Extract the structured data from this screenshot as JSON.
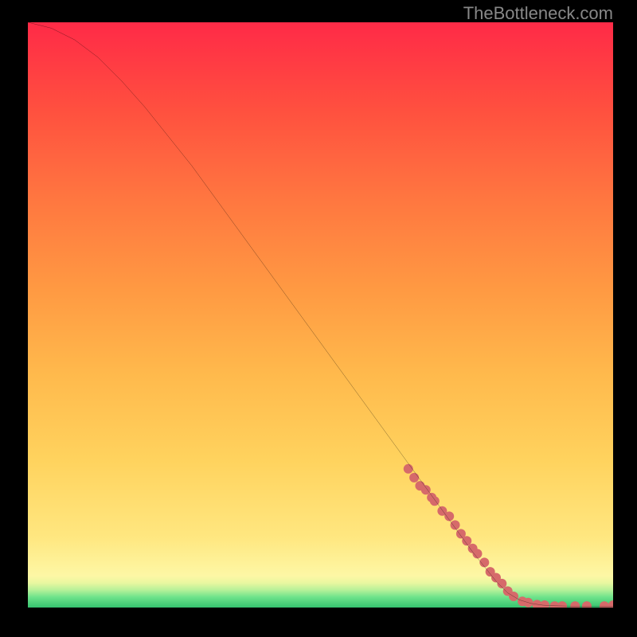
{
  "watermark": "TheBottleneck.com",
  "chart_data": {
    "type": "line",
    "title": "",
    "xlabel": "",
    "ylabel": "",
    "xlim": [
      0,
      100
    ],
    "ylim": [
      0,
      100
    ],
    "gradient_note": "Background is a vertical heatmap gradient from red (top) through orange/yellow to a thin green band at the bottom, representing bottleneck severity.",
    "series": [
      {
        "name": "curve",
        "color": "#000000",
        "x": [
          0,
          4,
          8,
          12,
          16,
          20,
          24,
          28,
          32,
          36,
          40,
          44,
          48,
          52,
          56,
          60,
          64,
          68,
          72,
          76,
          80,
          82,
          84,
          86,
          88,
          90,
          92,
          94,
          96,
          98,
          100
        ],
        "values": [
          100,
          99,
          97,
          94,
          90,
          85.5,
          80.5,
          75.5,
          70,
          64.5,
          59,
          53.5,
          48,
          42.5,
          37,
          31.5,
          26,
          20.5,
          15,
          9.5,
          4.5,
          2.5,
          1.3,
          0.7,
          0.4,
          0.3,
          0.25,
          0.22,
          0.2,
          0.2,
          0.22
        ]
      },
      {
        "name": "points",
        "color": "#d66a6a",
        "marker_radius_px": 6,
        "x": [
          65,
          66,
          67,
          68,
          69,
          69.5,
          70.8,
          72,
          73,
          74,
          75,
          76,
          76.8,
          78,
          79,
          80,
          81,
          82,
          83,
          84.5,
          85.5,
          87,
          88.3,
          90,
          91.3,
          93.5,
          95.5,
          98.5,
          100
        ],
        "values": [
          23.7,
          22.2,
          20.8,
          20.1,
          18.8,
          18.2,
          16.5,
          15.6,
          14.1,
          12.6,
          11.4,
          10.1,
          9.2,
          7.7,
          6.1,
          5.1,
          4.1,
          2.8,
          1.9,
          1.05,
          0.85,
          0.5,
          0.4,
          0.25,
          0.25,
          0.25,
          0.25,
          0.25,
          0.4
        ]
      }
    ]
  }
}
